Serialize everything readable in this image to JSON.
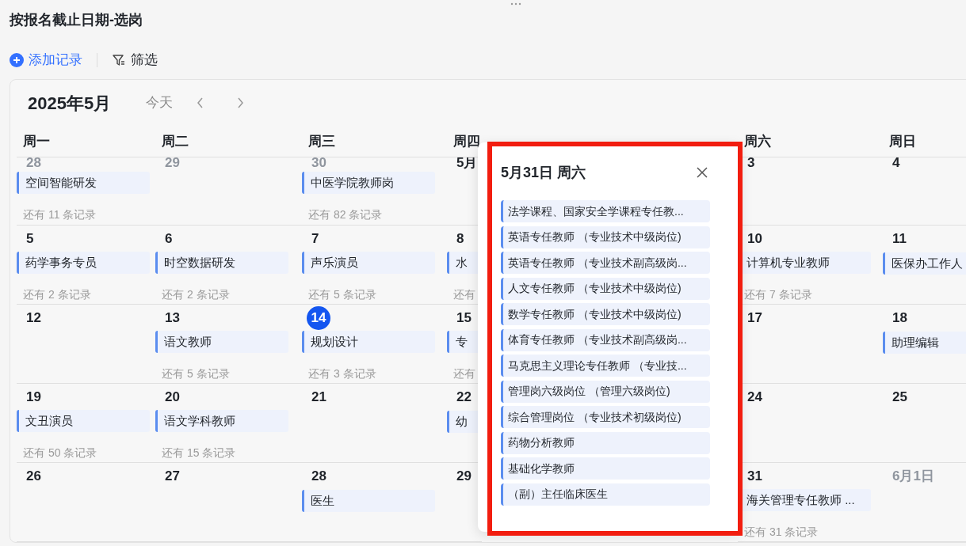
{
  "view_title": "按报名截止日期-选岗",
  "toolbar": [
    {
      "kind": "add",
      "label": "添加记录"
    },
    {
      "kind": "filter",
      "label": "筛选"
    }
  ],
  "calendar": {
    "month": "2025年5月",
    "today_button": "今天",
    "weekdays": [
      "周一",
      "周二",
      "周三",
      "周四",
      "周六",
      "周日"
    ],
    "weeks": [
      [
        {
          "date": "28",
          "muted": true,
          "today": false,
          "events": [
            "空间智能研发"
          ],
          "more": "还有 11 条记录"
        },
        {
          "date": "29",
          "muted": true,
          "today": false
        },
        {
          "date": "30",
          "muted": true,
          "today": false,
          "events": [
            "中医学院教师岗"
          ],
          "more": "还有 82 条记录"
        },
        {
          "date": "5月",
          "muted": false,
          "today": false
        },
        {
          "date": "3",
          "muted": false,
          "today": false
        },
        {
          "date": "4",
          "muted": false,
          "today": false
        }
      ],
      [
        {
          "date": "5",
          "muted": false,
          "today": false,
          "events": [
            "药学事务专员"
          ],
          "more": "还有 2 条记录"
        },
        {
          "date": "6",
          "muted": false,
          "today": false,
          "events": [
            "时空数据研发"
          ],
          "more": "还有 2 条记录"
        },
        {
          "date": "7",
          "muted": false,
          "today": false,
          "events": [
            "声乐演员"
          ],
          "more": "还有 5 条记录"
        },
        {
          "date": "8",
          "muted": false,
          "today": false,
          "events": [
            "水"
          ],
          "more": "还有"
        },
        {
          "date": "10",
          "muted": false,
          "today": false,
          "events": [
            "计算机专业教师"
          ],
          "more": "还有 7 条记录"
        },
        {
          "date": "11",
          "muted": false,
          "today": false,
          "events": [
            "医保办工作人"
          ]
        }
      ],
      [
        {
          "date": "12",
          "muted": false,
          "today": false
        },
        {
          "date": "13",
          "muted": false,
          "today": false,
          "events": [
            "语文教师"
          ],
          "more": "还有 5 条记录"
        },
        {
          "date": "14",
          "muted": false,
          "today": true,
          "events": [
            "规划设计"
          ],
          "more": "还有 3 条记录"
        },
        {
          "date": "15",
          "muted": false,
          "today": false,
          "events": [
            "专"
          ],
          "more": "还有"
        },
        {
          "date": "17",
          "muted": false,
          "today": false
        },
        {
          "date": "18",
          "muted": false,
          "today": false,
          "events": [
            "助理编辑"
          ]
        }
      ],
      [
        {
          "date": "19",
          "muted": false,
          "today": false,
          "events": [
            "文丑演员"
          ],
          "more": "还有 50 条记录"
        },
        {
          "date": "20",
          "muted": false,
          "today": false,
          "events": [
            "语文学科教师"
          ],
          "more": "还有 15 条记录"
        },
        {
          "date": "21",
          "muted": false,
          "today": false
        },
        {
          "date": "22",
          "muted": false,
          "today": false,
          "events": [
            "幼"
          ]
        },
        {
          "date": "24",
          "muted": false,
          "today": false
        },
        {
          "date": "25",
          "muted": false,
          "today": false
        }
      ],
      [
        {
          "date": "26",
          "muted": false,
          "today": false
        },
        {
          "date": "27",
          "muted": false,
          "today": false
        },
        {
          "date": "28",
          "muted": false,
          "today": false,
          "events": [
            "医生"
          ]
        },
        {
          "date": "29",
          "muted": false,
          "today": false
        },
        {
          "date": "31",
          "muted": false,
          "today": false,
          "events": [
            "海关管理专任教师 ..."
          ],
          "more": "还有 31 条记录"
        },
        {
          "date": "6月1日",
          "muted": true,
          "today": false
        }
      ]
    ]
  },
  "day_popup": {
    "title": "5月31日 周六",
    "events": [
      "法学课程、国家安全学课程专任教...",
      "英语专任教师 （专业技术中级岗位)",
      "英语专任教师 （专业技术副高级岗...",
      "人文专任教师 （专业技术中级岗位)",
      "数学专任教师 （专业技术中级岗位)",
      "体育专任教师 （专业技术副高级岗...",
      "马克思主义理论专任教师 （专业技...",
      "管理岗六级岗位 （管理六级岗位)",
      "综合管理岗位 （专业技术初级岗位)",
      "药物分析教师",
      "基础化学教师",
      "（副）主任临床医生"
    ]
  }
}
